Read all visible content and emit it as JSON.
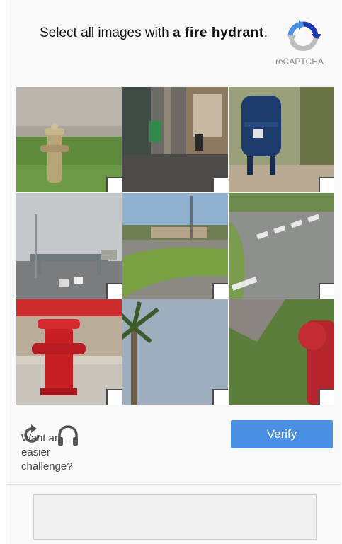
{
  "header": {
    "instruction_prefix": "Select all images with",
    "instruction_target": "a fire hydrant",
    "instruction_suffix": ".",
    "brand_label": "reCAPTCHA"
  },
  "grid": {
    "tiles": [
      {
        "row": 1,
        "col": 1,
        "content": "fire hydrant on grass",
        "checked": false
      },
      {
        "row": 1,
        "col": 2,
        "content": "storefront street",
        "checked": false
      },
      {
        "row": 1,
        "col": 3,
        "content": "blue mailbox",
        "checked": false
      },
      {
        "row": 2,
        "col": 1,
        "content": "highway overpass",
        "checked": false
      },
      {
        "row": 2,
        "col": 2,
        "content": "road curve with grass",
        "checked": false
      },
      {
        "row": 2,
        "col": 3,
        "content": "crosswalk intersection",
        "checked": false
      },
      {
        "row": 3,
        "col": 1,
        "content": "red fire hydrant",
        "checked": false
      },
      {
        "row": 3,
        "col": 2,
        "content": "palm tree",
        "checked": false
      },
      {
        "row": 3,
        "col": 3,
        "content": "red fire hydrant close-up",
        "checked": false
      }
    ]
  },
  "footer": {
    "easier_challenge_label": "Want an easier challenge?",
    "verify_label": "Verify"
  },
  "icons": {
    "reload": "reload-icon",
    "audio": "headphones-icon",
    "logo": "recaptcha-logo-icon"
  },
  "colors": {
    "verify_button": "#4a90e2",
    "panel_background": "#f9f9f9"
  }
}
